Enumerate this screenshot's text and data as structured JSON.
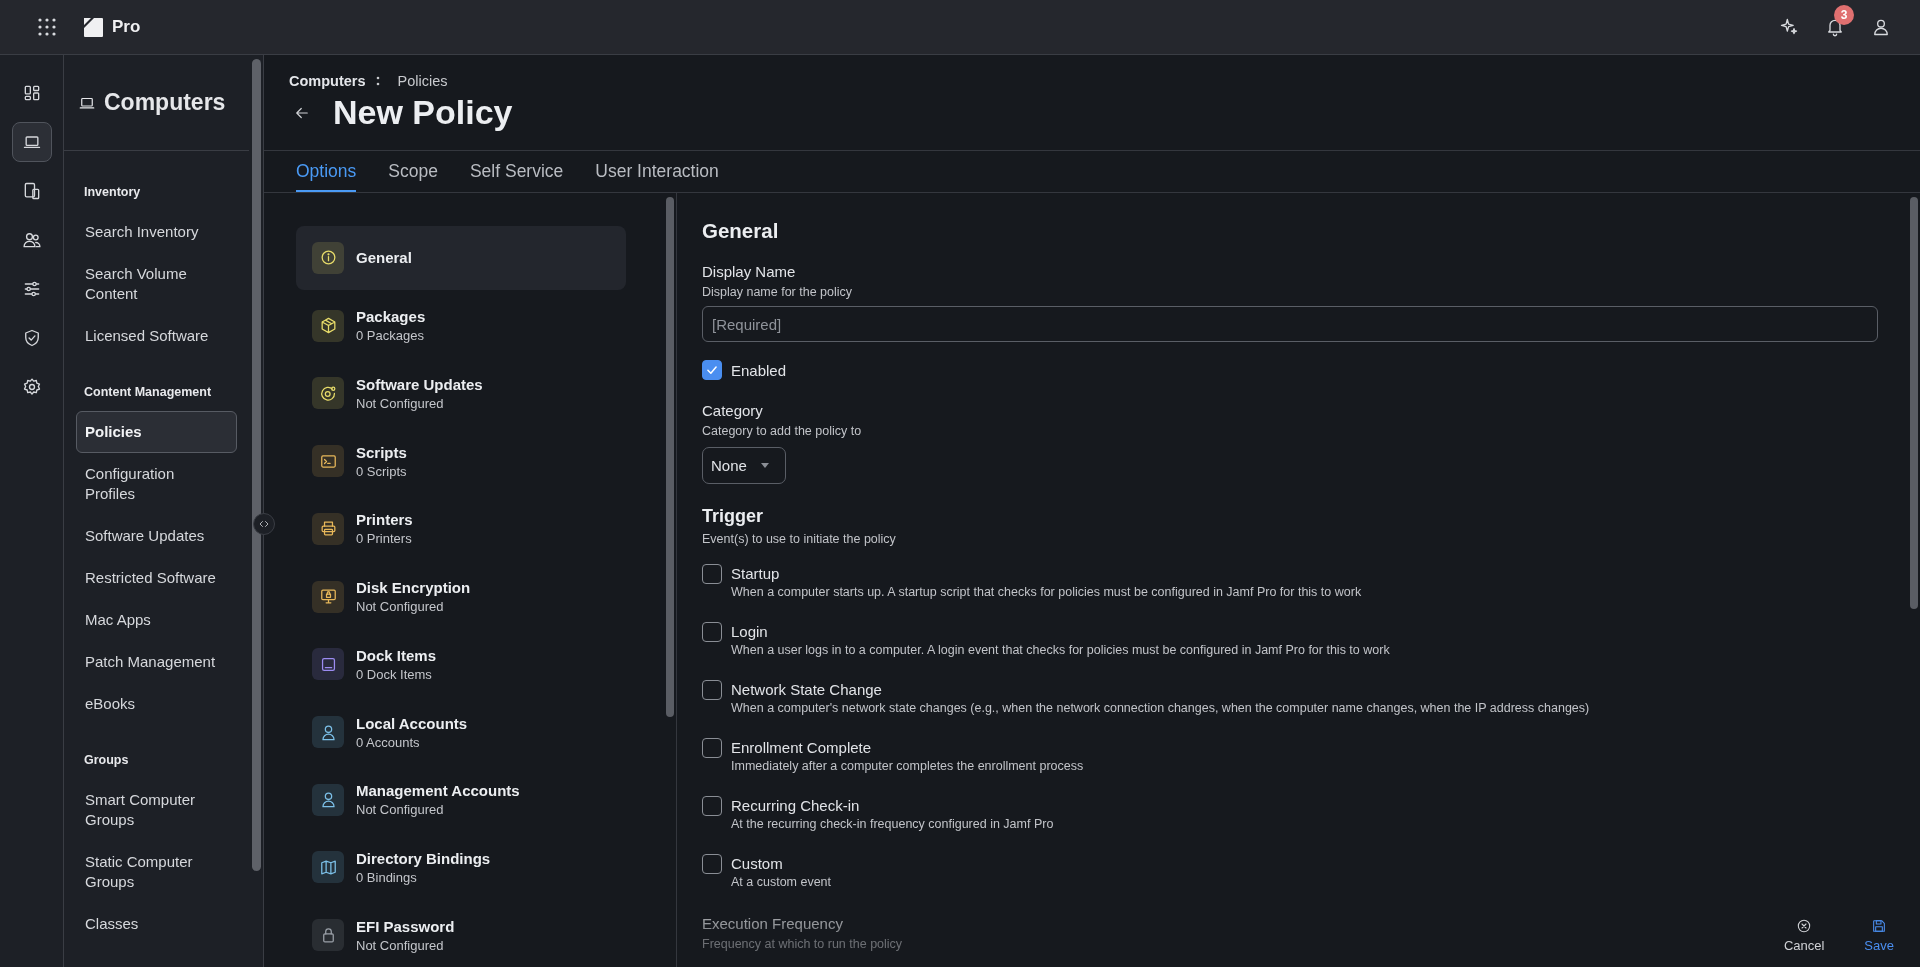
{
  "topbar": {
    "product": "Pro",
    "notifications": "3"
  },
  "rail": [
    {
      "selected": false
    },
    {
      "selected": true
    },
    {
      "selected": false
    },
    {
      "selected": false
    },
    {
      "selected": false
    },
    {
      "selected": false
    },
    {
      "selected": false
    }
  ],
  "sidebar": {
    "title": "Computers",
    "sections": [
      {
        "heading": "Inventory",
        "items": [
          {
            "label": "Search Inventory",
            "selected": false
          },
          {
            "label": "Search Volume Content",
            "selected": false
          },
          {
            "label": "Licensed Software",
            "selected": false
          }
        ]
      },
      {
        "heading": "Content Management",
        "items": [
          {
            "label": "Policies",
            "selected": true
          },
          {
            "label": "Configuration Profiles",
            "selected": false
          },
          {
            "label": "Software Updates",
            "selected": false
          },
          {
            "label": "Restricted Software",
            "selected": false
          },
          {
            "label": "Mac Apps",
            "selected": false
          },
          {
            "label": "Patch Management",
            "selected": false
          },
          {
            "label": "eBooks",
            "selected": false
          }
        ]
      },
      {
        "heading": "Groups",
        "items": [
          {
            "label": "Smart Computer Groups",
            "selected": false
          },
          {
            "label": "Static Computer Groups",
            "selected": false
          },
          {
            "label": "Classes",
            "selected": false
          }
        ]
      }
    ]
  },
  "breadcrumb": [
    "Computers",
    "Policies"
  ],
  "title": "New Policy",
  "tabs": [
    {
      "label": "Options",
      "selected": true
    },
    {
      "label": "Scope",
      "selected": false
    },
    {
      "label": "Self Service",
      "selected": false
    },
    {
      "label": "User Interaction",
      "selected": false
    }
  ],
  "options": [
    {
      "title": "General",
      "selected": true,
      "color": "#e8dc6a"
    },
    {
      "title": "Packages",
      "subtitle": "0 Packages",
      "selected": false,
      "color": "#e8dc6a"
    },
    {
      "title": "Software Updates",
      "subtitle": "Not Configured",
      "selected": false,
      "color": "#e8dc6a"
    },
    {
      "title": "Scripts",
      "subtitle": "0 Scripts",
      "selected": false,
      "color": "#e8b85a"
    },
    {
      "title": "Printers",
      "subtitle": "0 Printers",
      "selected": false,
      "color": "#e8b85a"
    },
    {
      "title": "Disk Encryption",
      "subtitle": "Not Configured",
      "selected": false,
      "color": "#e8b85a"
    },
    {
      "title": "Dock Items",
      "subtitle": "0 Dock Items",
      "selected": false,
      "color": "#9c8cf2"
    },
    {
      "title": "Local Accounts",
      "subtitle": "0 Accounts",
      "selected": false,
      "color": "#7cc0e8"
    },
    {
      "title": "Management Accounts",
      "subtitle": "Not Configured",
      "selected": false,
      "color": "#7cc0e8"
    },
    {
      "title": "Directory Bindings",
      "subtitle": "0 Bindings",
      "selected": false,
      "color": "#7cc0e8"
    },
    {
      "title": "EFI Password",
      "subtitle": "Not Configured",
      "selected": false,
      "color": "#9aa0a8"
    }
  ],
  "form": {
    "heading": "General",
    "display_name": {
      "label": "Display Name",
      "hint": "Display name for the policy",
      "placeholder": "[Required]"
    },
    "enabled": {
      "label": "Enabled",
      "checked": true
    },
    "category": {
      "label": "Category",
      "hint": "Category to add the policy to",
      "value": "None"
    },
    "trigger": {
      "heading": "Trigger",
      "hint": "Event(s) to use to initiate the policy",
      "events": [
        {
          "label": "Startup",
          "description": "When a computer starts up. A startup script that checks for policies must be configured in Jamf Pro for this to work",
          "checked": false
        },
        {
          "label": "Login",
          "description": "When a user logs in to a computer. A login event that checks for policies must be configured in Jamf Pro for this to work",
          "checked": false
        },
        {
          "label": "Network State Change",
          "description": "When a computer's network state changes (e.g., when the network connection changes, when the computer name changes, when the IP address changes)",
          "checked": false
        },
        {
          "label": "Enrollment Complete",
          "description": "Immediately after a computer completes the enrollment process",
          "checked": false
        },
        {
          "label": "Recurring Check-in",
          "description": "At the recurring check-in frequency configured in Jamf Pro",
          "checked": false
        },
        {
          "label": "Custom",
          "description": "At a custom event",
          "checked": false
        }
      ]
    },
    "execution_frequency": {
      "label": "Execution Frequency",
      "hint": "Frequency at which to run the policy"
    }
  },
  "actions": [
    {
      "label": "Cancel",
      "kind": "cancel"
    },
    {
      "label": "Save",
      "kind": "save"
    }
  ]
}
